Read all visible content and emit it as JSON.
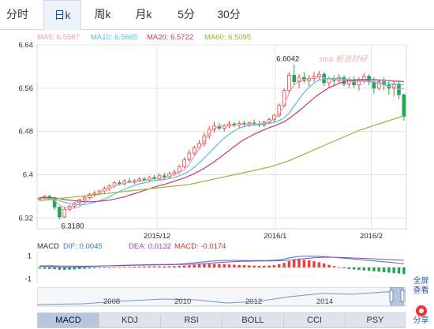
{
  "tabs": [
    {
      "label": "分时",
      "active": false
    },
    {
      "label": "日k",
      "active": true
    },
    {
      "label": "周k",
      "active": false
    },
    {
      "label": "月k",
      "active": false
    },
    {
      "label": "5分",
      "active": false
    },
    {
      "label": "30分",
      "active": false
    }
  ],
  "legend": {
    "ma5": "MA5: 6.5587",
    "ma10": "MA10: 6.5665",
    "ma20": "MA20: 6.5722",
    "ma60": "MA60: 6.5095"
  },
  "colors": {
    "ma5": "#e8a0b4",
    "ma10": "#4fc3e0",
    "ma20": "#c83a6a",
    "ma60": "#8fb838",
    "up": "#e8403a",
    "down": "#23a455",
    "grid": "#e4e4e4",
    "dif": "#2b7bc7",
    "dea": "#a040b8",
    "macd_label": "#c0392b"
  },
  "watermark": "sina 新浪财经",
  "macd_legend": {
    "title": "MACD",
    "dif": "DIF: 0.0045",
    "dea": "DEA: 0.0132",
    "macd": "MACD: -0.0174"
  },
  "navigator": {
    "years": [
      "2008",
      "2010",
      "2012",
      "2014"
    ]
  },
  "side_buttons": {
    "fullscreen": "全屏",
    "view": "查看",
    "share": "分享",
    "share_icon": "weibo-icon"
  },
  "indicator_tabs": [
    {
      "label": "MACD",
      "active": true
    },
    {
      "label": "KDJ",
      "active": false
    },
    {
      "label": "RSI",
      "active": false
    },
    {
      "label": "BOLL",
      "active": false
    },
    {
      "label": "CCI",
      "active": false
    },
    {
      "label": "PSY",
      "active": false
    }
  ],
  "chart_data": [
    {
      "type": "candlestick",
      "ylim": [
        6.3,
        6.64
      ],
      "yticks": [
        6.32,
        6.4,
        6.48,
        6.56,
        6.64
      ],
      "xticks": [
        "2015/12",
        "2016/1",
        "2016/2"
      ],
      "annotations": {
        "high": "6.6042",
        "low": "6.3180"
      },
      "ohlc": [
        [
          6.355,
          6.358,
          6.352,
          6.356
        ],
        [
          6.356,
          6.362,
          6.353,
          6.36
        ],
        [
          6.36,
          6.363,
          6.355,
          6.357
        ],
        [
          6.357,
          6.36,
          6.335,
          6.34
        ],
        [
          6.34,
          6.341,
          6.318,
          6.322
        ],
        [
          6.322,
          6.34,
          6.32,
          6.336
        ],
        [
          6.336,
          6.344,
          6.332,
          6.342
        ],
        [
          6.342,
          6.35,
          6.338,
          6.348
        ],
        [
          6.348,
          6.356,
          6.345,
          6.354
        ],
        [
          6.354,
          6.362,
          6.35,
          6.358
        ],
        [
          6.358,
          6.366,
          6.356,
          6.364
        ],
        [
          6.364,
          6.37,
          6.36,
          6.366
        ],
        [
          6.366,
          6.372,
          6.362,
          6.37
        ],
        [
          6.37,
          6.378,
          6.366,
          6.375
        ],
        [
          6.375,
          6.382,
          6.37,
          6.379
        ],
        [
          6.379,
          6.388,
          6.376,
          6.385
        ],
        [
          6.385,
          6.39,
          6.38,
          6.383
        ],
        [
          6.383,
          6.392,
          6.38,
          6.388
        ],
        [
          6.388,
          6.394,
          6.384,
          6.386
        ],
        [
          6.386,
          6.392,
          6.382,
          6.389
        ],
        [
          6.389,
          6.396,
          6.386,
          6.392
        ],
        [
          6.392,
          6.396,
          6.388,
          6.39
        ],
        [
          6.39,
          6.398,
          6.388,
          6.395
        ],
        [
          6.395,
          6.4,
          6.39,
          6.392
        ],
        [
          6.392,
          6.402,
          6.39,
          6.398
        ],
        [
          6.398,
          6.404,
          6.392,
          6.396
        ],
        [
          6.396,
          6.406,
          6.394,
          6.402
        ],
        [
          6.402,
          6.41,
          6.398,
          6.405
        ],
        [
          6.405,
          6.418,
          6.402,
          6.415
        ],
        [
          6.415,
          6.432,
          6.412,
          6.428
        ],
        [
          6.428,
          6.446,
          6.424,
          6.44
        ],
        [
          6.44,
          6.454,
          6.436,
          6.45
        ],
        [
          6.45,
          6.464,
          6.446,
          6.458
        ],
        [
          6.458,
          6.478,
          6.452,
          6.472
        ],
        [
          6.472,
          6.49,
          6.466,
          6.484
        ],
        [
          6.484,
          6.498,
          6.478,
          6.49
        ],
        [
          6.49,
          6.496,
          6.482,
          6.486
        ],
        [
          6.486,
          6.494,
          6.48,
          6.49
        ],
        [
          6.49,
          6.5,
          6.486,
          6.494
        ],
        [
          6.494,
          6.498,
          6.488,
          6.492
        ],
        [
          6.492,
          6.5,
          6.486,
          6.495
        ],
        [
          6.495,
          6.5,
          6.49,
          6.493
        ],
        [
          6.493,
          6.498,
          6.488,
          6.496
        ],
        [
          6.496,
          6.502,
          6.49,
          6.494
        ],
        [
          6.494,
          6.5,
          6.488,
          6.492
        ],
        [
          6.492,
          6.5,
          6.488,
          6.497
        ],
        [
          6.497,
          6.506,
          6.494,
          6.502
        ],
        [
          6.502,
          6.512,
          6.498,
          6.51
        ],
        [
          6.51,
          6.532,
          6.506,
          6.528
        ],
        [
          6.528,
          6.56,
          6.524,
          6.556
        ],
        [
          6.556,
          6.59,
          6.55,
          6.584
        ],
        [
          6.584,
          6.604,
          6.566,
          6.572
        ],
        [
          6.572,
          6.586,
          6.56,
          6.58
        ],
        [
          6.58,
          6.59,
          6.57,
          6.574
        ],
        [
          6.574,
          6.584,
          6.564,
          6.578
        ],
        [
          6.578,
          6.59,
          6.572,
          6.582
        ],
        [
          6.582,
          6.592,
          6.574,
          6.586
        ],
        [
          6.586,
          6.59,
          6.564,
          6.57
        ],
        [
          6.57,
          6.582,
          6.56,
          6.578
        ],
        [
          6.578,
          6.584,
          6.566,
          6.574
        ],
        [
          6.574,
          6.586,
          6.568,
          6.58
        ],
        [
          6.58,
          6.584,
          6.564,
          6.568
        ],
        [
          6.568,
          6.58,
          6.56,
          6.576
        ],
        [
          6.576,
          6.582,
          6.56,
          6.566
        ],
        [
          6.566,
          6.58,
          6.556,
          6.574
        ],
        [
          6.574,
          6.588,
          6.568,
          6.582
        ],
        [
          6.582,
          6.586,
          6.566,
          6.572
        ],
        [
          6.572,
          6.58,
          6.55,
          6.56
        ],
        [
          6.56,
          6.576,
          6.556,
          6.572
        ],
        [
          6.572,
          6.58,
          6.556,
          6.566
        ],
        [
          6.566,
          6.574,
          6.548,
          6.56
        ],
        [
          6.56,
          6.572,
          6.545,
          6.568
        ],
        [
          6.568,
          6.572,
          6.54,
          6.548
        ],
        [
          6.548,
          6.55,
          6.5,
          6.508
        ]
      ],
      "series": [
        {
          "name": "MA5",
          "values": [
            6.356,
            6.356,
            6.355,
            6.353,
            6.343,
            6.34,
            6.339,
            6.338,
            6.341,
            6.348,
            6.355,
            6.36,
            6.366,
            6.37,
            6.374,
            6.379,
            6.382,
            6.384,
            6.386,
            6.387,
            6.388,
            6.389,
            6.391,
            6.392,
            6.393,
            6.394,
            6.397,
            6.4,
            6.404,
            6.409,
            6.42,
            6.434,
            6.448,
            6.462,
            6.476,
            6.486,
            6.49,
            6.491,
            6.491,
            6.491,
            6.492,
            6.493,
            6.494,
            6.494,
            6.494,
            6.495,
            6.498,
            6.503,
            6.512,
            6.528,
            6.552,
            6.566,
            6.574,
            6.576,
            6.577,
            6.579,
            6.581,
            6.579,
            6.577,
            6.576,
            6.576,
            6.574,
            6.574,
            6.572,
            6.572,
            6.574,
            6.575,
            6.572,
            6.568,
            6.566,
            6.563,
            6.562,
            6.558,
            6.559
          ]
        },
        {
          "name": "MA10",
          "values": [
            6.357,
            6.357,
            6.356,
            6.355,
            6.352,
            6.349,
            6.347,
            6.345,
            6.344,
            6.345,
            6.347,
            6.349,
            6.352,
            6.355,
            6.359,
            6.364,
            6.369,
            6.373,
            6.377,
            6.38,
            6.383,
            6.385,
            6.387,
            6.389,
            6.39,
            6.391,
            6.393,
            6.395,
            6.398,
            6.402,
            6.407,
            6.414,
            6.422,
            6.431,
            6.44,
            6.45,
            6.459,
            6.468,
            6.475,
            6.481,
            6.486,
            6.489,
            6.491,
            6.492,
            6.493,
            6.494,
            6.495,
            6.497,
            6.5,
            6.505,
            6.514,
            6.527,
            6.54,
            6.552,
            6.562,
            6.57,
            6.575,
            6.577,
            6.578,
            6.578,
            6.578,
            6.577,
            6.576,
            6.575,
            6.574,
            6.573,
            6.572,
            6.571,
            6.57,
            6.569,
            6.568,
            6.567,
            6.566,
            6.5665
          ]
        },
        {
          "name": "MA20",
          "values": [
            6.358,
            6.358,
            6.358,
            6.357,
            6.356,
            6.354,
            6.353,
            6.352,
            6.351,
            6.35,
            6.35,
            6.35,
            6.351,
            6.352,
            6.353,
            6.355,
            6.357,
            6.359,
            6.362,
            6.365,
            6.368,
            6.371,
            6.374,
            6.377,
            6.38,
            6.382,
            6.385,
            6.388,
            6.391,
            6.394,
            6.398,
            6.402,
            6.407,
            6.412,
            6.418,
            6.424,
            6.431,
            6.438,
            6.445,
            6.452,
            6.459,
            6.465,
            6.47,
            6.475,
            6.479,
            6.483,
            6.487,
            6.49,
            6.494,
            6.498,
            6.504,
            6.511,
            6.518,
            6.526,
            6.534,
            6.542,
            6.549,
            6.555,
            6.561,
            6.565,
            6.569,
            6.572,
            6.574,
            6.575,
            6.576,
            6.576,
            6.576,
            6.576,
            6.575,
            6.575,
            6.574,
            6.573,
            6.573,
            6.5722
          ]
        },
        {
          "name": "MA60",
          "values": [
            6.352,
            6.353,
            6.354,
            6.355,
            6.356,
            6.357,
            6.358,
            6.359,
            6.36,
            6.361,
            6.362,
            6.363,
            6.364,
            6.365,
            6.366,
            6.367,
            6.368,
            6.369,
            6.37,
            6.371,
            6.372,
            6.373,
            6.374,
            6.375,
            6.376,
            6.377,
            6.378,
            6.379,
            6.38,
            6.381,
            6.382,
            6.384,
            6.386,
            6.388,
            6.39,
            6.392,
            6.394,
            6.396,
            6.398,
            6.4,
            6.402,
            6.404,
            6.406,
            6.408,
            6.41,
            6.412,
            6.414,
            6.417,
            6.42,
            6.423,
            6.426,
            6.43,
            6.434,
            6.438,
            6.442,
            6.446,
            6.45,
            6.454,
            6.458,
            6.462,
            6.466,
            6.47,
            6.474,
            6.478,
            6.482,
            6.485,
            6.488,
            6.491,
            6.494,
            6.497,
            6.5,
            6.503,
            6.506,
            6.5095
          ]
        }
      ]
    },
    {
      "type": "bar",
      "ylim": [
        -1.4,
        1.4
      ],
      "yticks": [
        1,
        -1
      ],
      "macd_bars": [
        -0.1,
        -0.12,
        -0.14,
        -0.16,
        -0.2,
        -0.22,
        -0.2,
        -0.18,
        -0.15,
        -0.12,
        -0.1,
        -0.08,
        -0.06,
        -0.04,
        -0.02,
        0.02,
        0.04,
        0.05,
        0.06,
        0.07,
        0.08,
        0.09,
        0.1,
        0.1,
        0.1,
        0.1,
        0.11,
        0.12,
        0.14,
        0.17,
        0.2,
        0.24,
        0.28,
        0.3,
        0.32,
        0.32,
        0.3,
        0.28,
        0.26,
        0.24,
        0.22,
        0.2,
        0.18,
        0.16,
        0.15,
        0.15,
        0.17,
        0.2,
        0.28,
        0.4,
        0.56,
        0.66,
        0.7,
        0.68,
        0.62,
        0.55,
        0.46,
        0.36,
        0.24,
        0.12,
        0.02,
        -0.08,
        -0.14,
        -0.18,
        -0.22,
        -0.26,
        -0.3,
        -0.34,
        -0.38,
        -0.42,
        -0.46,
        -0.5,
        -0.54,
        -0.58
      ],
      "dif": [
        0.1,
        0.09,
        0.08,
        0.06,
        0.03,
        0.02,
        0.02,
        0.03,
        0.04,
        0.06,
        0.08,
        0.1,
        0.12,
        0.13,
        0.14,
        0.16,
        0.18,
        0.2,
        0.21,
        0.22,
        0.23,
        0.24,
        0.25,
        0.25,
        0.26,
        0.26,
        0.27,
        0.28,
        0.3,
        0.33,
        0.37,
        0.41,
        0.46,
        0.5,
        0.55,
        0.58,
        0.6,
        0.61,
        0.62,
        0.62,
        0.62,
        0.62,
        0.62,
        0.61,
        0.61,
        0.61,
        0.62,
        0.64,
        0.68,
        0.74,
        0.84,
        0.92,
        0.98,
        1.0,
        1.0,
        1.0,
        0.98,
        0.96,
        0.93,
        0.9,
        0.86,
        0.82,
        0.78,
        0.74,
        0.7,
        0.66,
        0.62,
        0.58,
        0.54,
        0.5,
        0.46,
        0.42,
        0.38,
        0.32
      ],
      "dea": [
        0.15,
        0.15,
        0.15,
        0.14,
        0.13,
        0.12,
        0.12,
        0.12,
        0.11,
        0.11,
        0.12,
        0.12,
        0.13,
        0.14,
        0.15,
        0.15,
        0.16,
        0.17,
        0.18,
        0.19,
        0.2,
        0.21,
        0.22,
        0.22,
        0.23,
        0.24,
        0.24,
        0.25,
        0.26,
        0.27,
        0.28,
        0.3,
        0.32,
        0.35,
        0.38,
        0.41,
        0.44,
        0.47,
        0.49,
        0.51,
        0.53,
        0.54,
        0.55,
        0.56,
        0.57,
        0.58,
        0.58,
        0.59,
        0.6,
        0.62,
        0.65,
        0.69,
        0.74,
        0.78,
        0.82,
        0.86,
        0.88,
        0.9,
        0.9,
        0.9,
        0.89,
        0.88,
        0.86,
        0.84,
        0.82,
        0.8,
        0.78,
        0.76,
        0.74,
        0.72,
        0.7,
        0.68,
        0.66,
        0.64
      ]
    }
  ]
}
